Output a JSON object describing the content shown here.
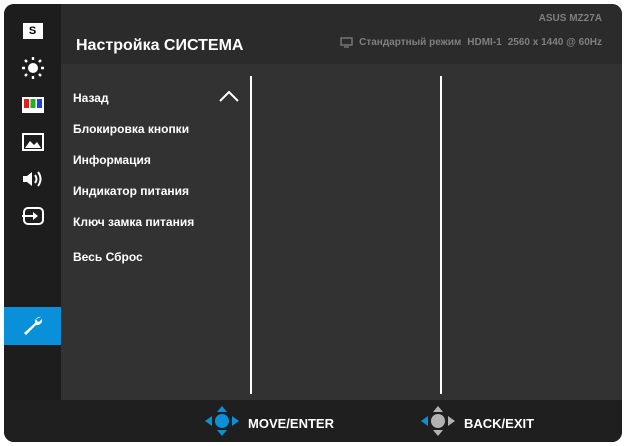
{
  "header": {
    "title": "Настройка СИСТЕМА",
    "model": "ASUS MZ27A",
    "mode": "Стандартный режим",
    "input": "HDMI-1",
    "resolution": "2560 x 1440 @ 60Hz"
  },
  "sidebar": {
    "items": [
      {
        "icon": "splendid-s-icon",
        "label": "S"
      },
      {
        "icon": "bluelight-icon"
      },
      {
        "icon": "color-icon"
      },
      {
        "icon": "image-icon"
      },
      {
        "icon": "sound-icon"
      },
      {
        "icon": "input-icon"
      },
      {
        "icon": "wrench-icon",
        "active": true
      }
    ]
  },
  "menu": {
    "items": [
      "Назад",
      "Блокировка кнопки",
      "Информация",
      "Индикатор питания",
      "Ключ замка питания",
      "Весь Сброс"
    ]
  },
  "footer": {
    "move_label": "MOVE/ENTER",
    "back_label": "BACK/EXIT"
  },
  "colors": {
    "accent": "#0a90d8",
    "background": "#323232"
  }
}
